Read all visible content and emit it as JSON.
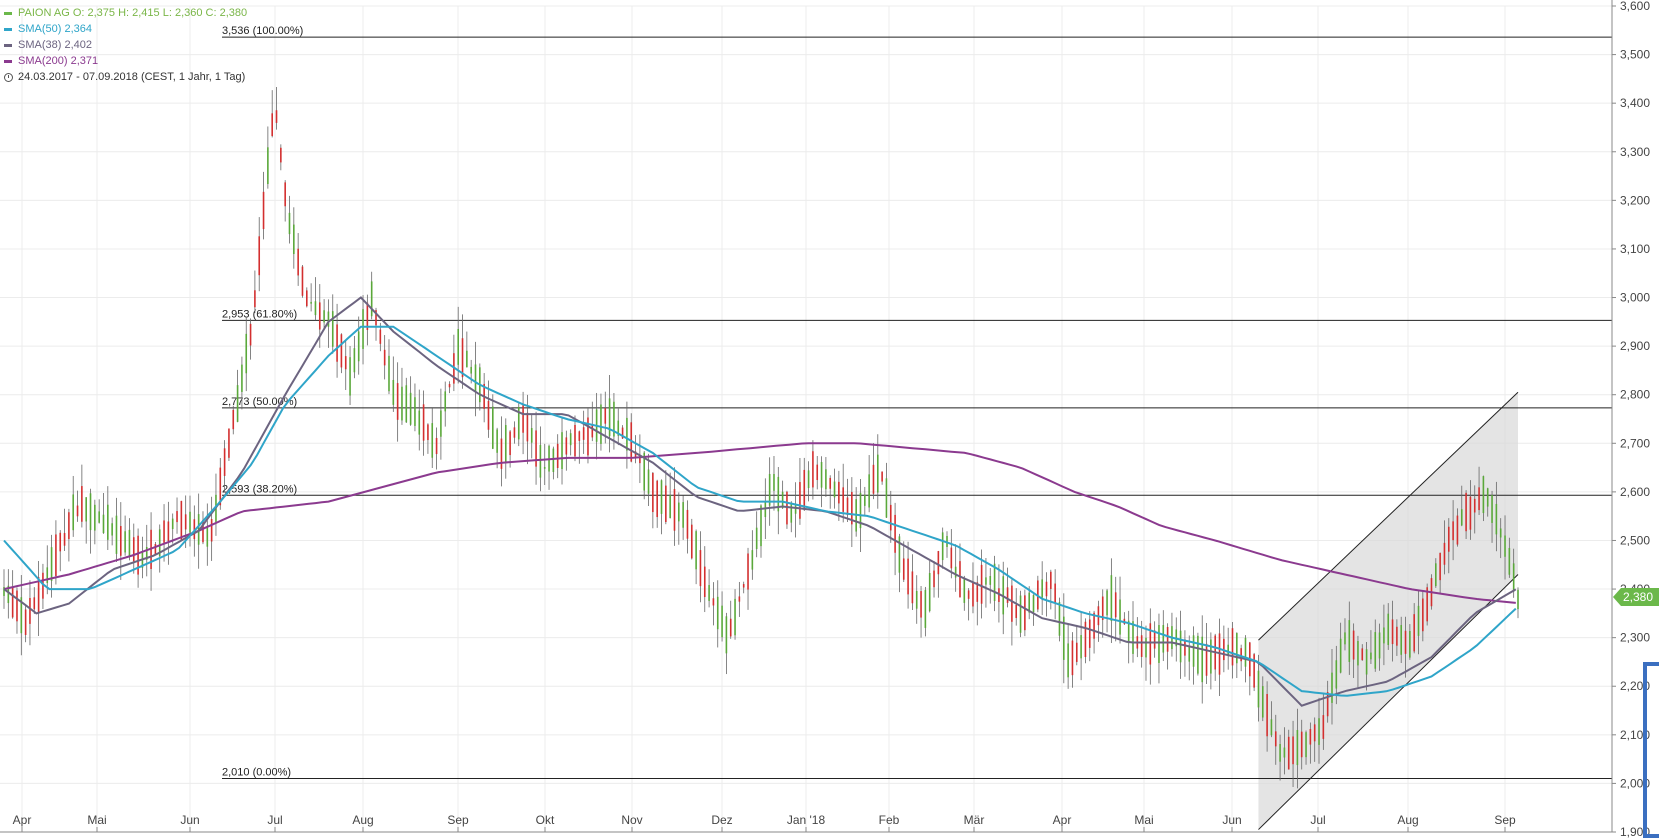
{
  "legend": {
    "title_name": "PAION AG",
    "ohlc": "O: 2,375  H: 2,415  L: 2,360  C: 2,380",
    "sma50_label": "SMA(50)",
    "sma50_value": "2,364",
    "sma38_label": "SMA(38)",
    "sma38_value": "2,402",
    "sma200_label": "SMA(200)",
    "sma200_value": "2,371",
    "range_text": "24.03.2017 - 07.09.2018",
    "range_detail": "(CEST, 1 Jahr, 1 Tag)"
  },
  "colors": {
    "up": "#5aa83a",
    "down": "#d32f2f",
    "sma50": "#2fa5c9",
    "sma38": "#6c6480",
    "sma200": "#8b3a8f",
    "channel": "#d9d9d9",
    "price_tag": "#6bb84a"
  },
  "last_price_label": "2,380",
  "chart_data": {
    "type": "candlestick",
    "x_ticks": [
      "Apr",
      "Mai",
      "Jun",
      "Jul",
      "Aug",
      "Sep",
      "Okt",
      "Nov",
      "Dez",
      "Jan '18",
      "Feb",
      "Mär",
      "Apr",
      "Mai",
      "Jun",
      "Jul",
      "Aug",
      "Sep"
    ],
    "y_ticks": [
      "1,900",
      "2,000",
      "2,100",
      "2,200",
      "2,300",
      "2,400",
      "2,500",
      "2,600",
      "2,700",
      "2,800",
      "2,900",
      "3,000",
      "3,100",
      "3,200",
      "3,300",
      "3,400",
      "3,500",
      "3,600"
    ],
    "ylim": [
      1.9,
      3.6
    ],
    "fib_levels": [
      {
        "label": "3,536 (100.00%)",
        "value": 3.536
      },
      {
        "label": "2,953 (61.80%)",
        "value": 2.953
      },
      {
        "label": "2,773 (50.00%)",
        "value": 2.773
      },
      {
        "label": "2,593 (38.20%)",
        "value": 2.593
      },
      {
        "label": "2,010 (0.00%)",
        "value": 2.01
      }
    ],
    "price_anchors": [
      [
        0,
        2.4
      ],
      [
        10,
        2.33
      ],
      [
        22,
        2.45
      ],
      [
        35,
        2.58
      ],
      [
        50,
        2.52
      ],
      [
        65,
        2.46
      ],
      [
        80,
        2.55
      ],
      [
        95,
        2.5
      ],
      [
        105,
        2.72
      ],
      [
        115,
        2.95
      ],
      [
        125,
        3.4
      ],
      [
        132,
        3.15
      ],
      [
        140,
        3.0
      ],
      [
        150,
        2.95
      ],
      [
        160,
        2.84
      ],
      [
        170,
        3.0
      ],
      [
        180,
        2.8
      ],
      [
        190,
        2.76
      ],
      [
        200,
        2.7
      ],
      [
        210,
        2.9
      ],
      [
        220,
        2.82
      ],
      [
        230,
        2.68
      ],
      [
        240,
        2.75
      ],
      [
        250,
        2.65
      ],
      [
        260,
        2.7
      ],
      [
        270,
        2.72
      ],
      [
        280,
        2.76
      ],
      [
        290,
        2.7
      ],
      [
        300,
        2.6
      ],
      [
        315,
        2.55
      ],
      [
        325,
        2.4
      ],
      [
        335,
        2.3
      ],
      [
        345,
        2.45
      ],
      [
        355,
        2.62
      ],
      [
        365,
        2.55
      ],
      [
        375,
        2.65
      ],
      [
        385,
        2.6
      ],
      [
        395,
        2.55
      ],
      [
        405,
        2.65
      ],
      [
        415,
        2.45
      ],
      [
        425,
        2.35
      ],
      [
        435,
        2.5
      ],
      [
        445,
        2.38
      ],
      [
        455,
        2.42
      ],
      [
        470,
        2.35
      ],
      [
        485,
        2.42
      ],
      [
        492,
        2.25
      ],
      [
        500,
        2.3
      ],
      [
        512,
        2.38
      ],
      [
        525,
        2.28
      ],
      [
        540,
        2.3
      ],
      [
        555,
        2.25
      ],
      [
        565,
        2.28
      ],
      [
        575,
        2.26
      ],
      [
        580,
        2.2
      ],
      [
        590,
        2.06
      ],
      [
        600,
        2.08
      ],
      [
        610,
        2.12
      ],
      [
        620,
        2.3
      ],
      [
        630,
        2.25
      ],
      [
        640,
        2.32
      ],
      [
        650,
        2.28
      ],
      [
        660,
        2.4
      ],
      [
        668,
        2.5
      ],
      [
        675,
        2.55
      ],
      [
        685,
        2.6
      ],
      [
        695,
        2.48
      ],
      [
        700,
        2.38
      ]
    ],
    "sma50_anchors": [
      [
        0,
        2.5
      ],
      [
        20,
        2.4
      ],
      [
        40,
        2.4
      ],
      [
        60,
        2.44
      ],
      [
        80,
        2.48
      ],
      [
        100,
        2.58
      ],
      [
        115,
        2.66
      ],
      [
        130,
        2.78
      ],
      [
        150,
        2.88
      ],
      [
        165,
        2.94
      ],
      [
        180,
        2.94
      ],
      [
        200,
        2.88
      ],
      [
        220,
        2.82
      ],
      [
        240,
        2.78
      ],
      [
        260,
        2.75
      ],
      [
        280,
        2.73
      ],
      [
        300,
        2.68
      ],
      [
        320,
        2.61
      ],
      [
        340,
        2.58
      ],
      [
        360,
        2.58
      ],
      [
        380,
        2.56
      ],
      [
        400,
        2.55
      ],
      [
        420,
        2.52
      ],
      [
        440,
        2.49
      ],
      [
        460,
        2.44
      ],
      [
        480,
        2.38
      ],
      [
        500,
        2.35
      ],
      [
        520,
        2.33
      ],
      [
        540,
        2.3
      ],
      [
        560,
        2.28
      ],
      [
        580,
        2.25
      ],
      [
        600,
        2.19
      ],
      [
        620,
        2.18
      ],
      [
        640,
        2.19
      ],
      [
        660,
        2.22
      ],
      [
        680,
        2.28
      ],
      [
        700,
        2.364
      ]
    ],
    "sma38_anchors": [
      [
        0,
        2.4
      ],
      [
        15,
        2.35
      ],
      [
        30,
        2.37
      ],
      [
        50,
        2.44
      ],
      [
        70,
        2.47
      ],
      [
        90,
        2.52
      ],
      [
        110,
        2.64
      ],
      [
        130,
        2.8
      ],
      [
        150,
        2.95
      ],
      [
        165,
        3.0
      ],
      [
        180,
        2.93
      ],
      [
        200,
        2.86
      ],
      [
        220,
        2.8
      ],
      [
        240,
        2.76
      ],
      [
        260,
        2.76
      ],
      [
        280,
        2.71
      ],
      [
        300,
        2.66
      ],
      [
        320,
        2.59
      ],
      [
        340,
        2.56
      ],
      [
        360,
        2.57
      ],
      [
        380,
        2.56
      ],
      [
        400,
        2.53
      ],
      [
        420,
        2.48
      ],
      [
        440,
        2.43
      ],
      [
        460,
        2.39
      ],
      [
        480,
        2.34
      ],
      [
        500,
        2.32
      ],
      [
        520,
        2.29
      ],
      [
        540,
        2.29
      ],
      [
        560,
        2.27
      ],
      [
        580,
        2.25
      ],
      [
        600,
        2.16
      ],
      [
        620,
        2.19
      ],
      [
        640,
        2.21
      ],
      [
        660,
        2.26
      ],
      [
        680,
        2.35
      ],
      [
        700,
        2.402
      ]
    ],
    "sma200_anchors": [
      [
        0,
        2.4
      ],
      [
        30,
        2.43
      ],
      [
        60,
        2.47
      ],
      [
        90,
        2.52
      ],
      [
        110,
        2.56
      ],
      [
        130,
        2.57
      ],
      [
        150,
        2.58
      ],
      [
        175,
        2.61
      ],
      [
        200,
        2.64
      ],
      [
        230,
        2.66
      ],
      [
        260,
        2.67
      ],
      [
        290,
        2.67
      ],
      [
        320,
        2.68
      ],
      [
        345,
        2.69
      ],
      [
        370,
        2.7
      ],
      [
        395,
        2.7
      ],
      [
        420,
        2.69
      ],
      [
        445,
        2.68
      ],
      [
        470,
        2.65
      ],
      [
        495,
        2.6
      ],
      [
        515,
        2.57
      ],
      [
        535,
        2.53
      ],
      [
        560,
        2.5
      ],
      [
        590,
        2.46
      ],
      [
        620,
        2.43
      ],
      [
        650,
        2.4
      ],
      [
        680,
        2.38
      ],
      [
        700,
        2.371
      ]
    ]
  }
}
